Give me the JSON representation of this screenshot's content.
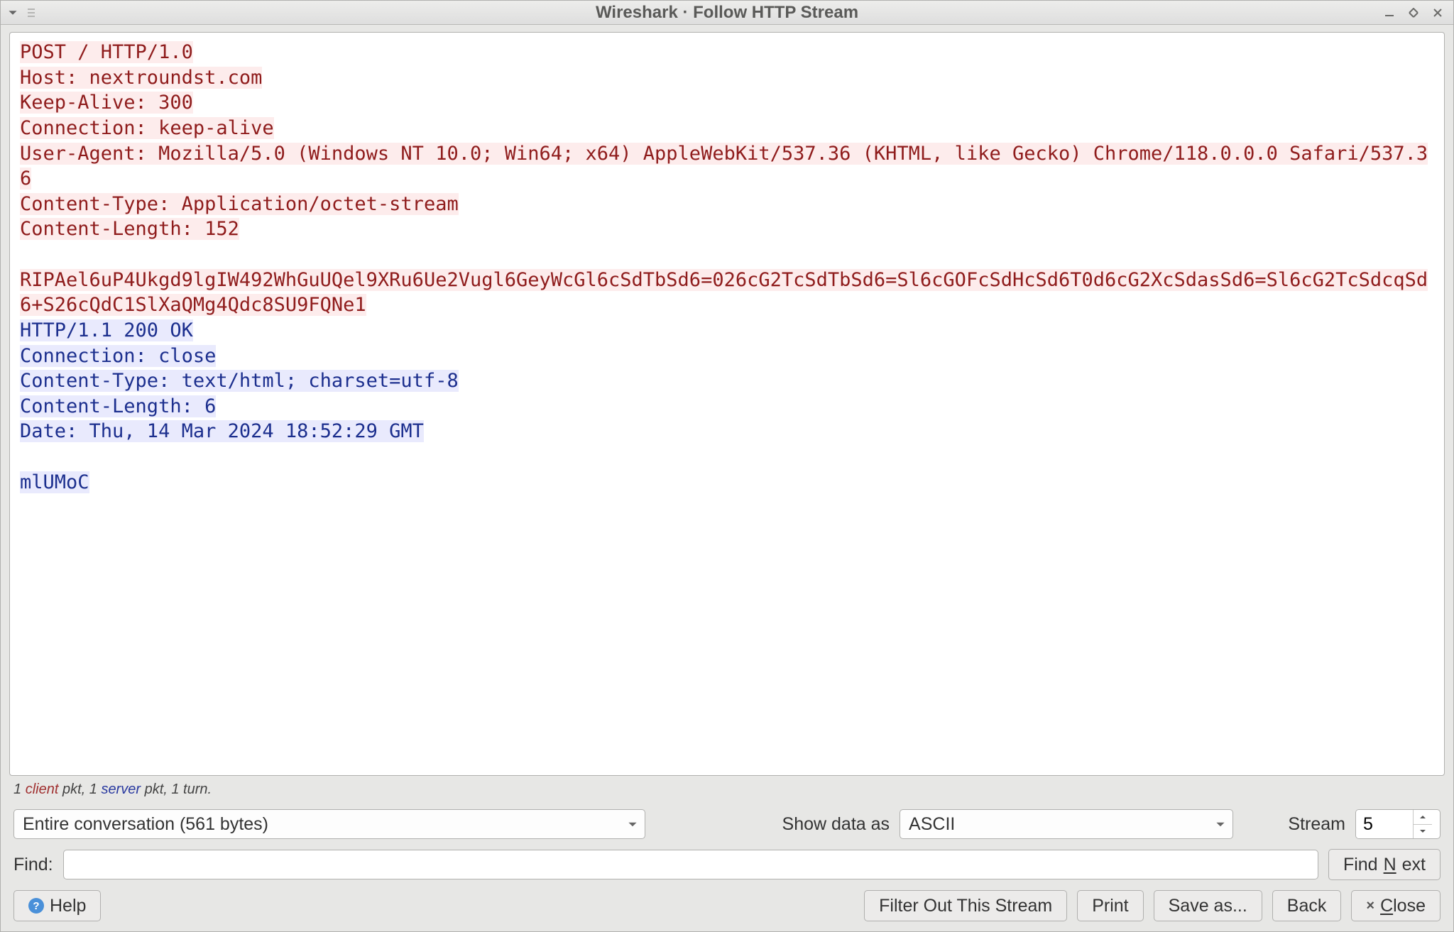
{
  "window": {
    "title": "Wireshark · Follow HTTP Stream"
  },
  "stream": {
    "request": "POST / HTTP/1.0\nHost: nextroundst.com\nKeep-Alive: 300\nConnection: keep-alive\nUser-Agent: Mozilla/5.0 (Windows NT 10.0; Win64; x64) AppleWebKit/537.36 (KHTML, like Gecko) Chrome/118.0.0.0 Safari/537.36\nContent-Type: Application/octet-stream\nContent-Length: 152\n\nRIPAel6uP4Ukgd9lgIW492WhGuUQel9XRu6Ue2Vugl6GeyWcGl6cSdTbSd6=026cG2TcSdTbSd6=Sl6cGOFcSdHcSd6T0d6cG2XcSdasSd6=Sl6cG2TcSdcqSd6+S26cQdC1SlXaQMg4Qdc8SU9FQNe1",
    "response": "HTTP/1.1 200 OK\nConnection: close\nContent-Type: text/html; charset=utf-8\nContent-Length: 6\nDate: Thu, 14 Mar 2024 18:52:29 GMT\n\nmlUMoC"
  },
  "status": {
    "client_count": "1",
    "client_word": "client",
    "mid1": " pkt, ",
    "server_count": "1",
    "server_word": "server",
    "tail": " pkt, 1 turn."
  },
  "controls": {
    "conversation_selected": "Entire conversation (561 bytes)",
    "show_data_as_label": "Show data as",
    "show_data_as_value": "ASCII",
    "stream_label": "Stream",
    "stream_value": "5",
    "find_label": "Find:",
    "find_value": "",
    "find_next_pre": "Find ",
    "find_next_key": "N",
    "find_next_post": "ext"
  },
  "buttons": {
    "help": "Help",
    "filter_out": "Filter Out This Stream",
    "print": "Print",
    "save_as": "Save as...",
    "back": "Back",
    "close_key": "C",
    "close_post": "lose"
  }
}
